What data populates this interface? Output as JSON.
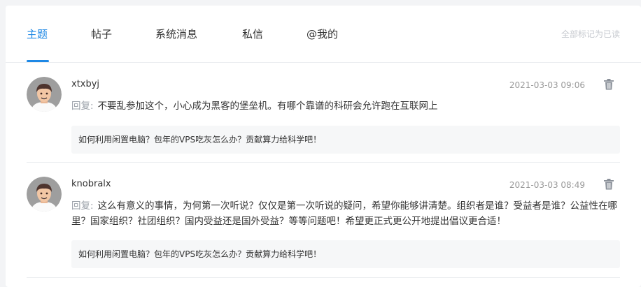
{
  "tabs": [
    {
      "label": "主题",
      "active": true
    },
    {
      "label": "帖子",
      "active": false
    },
    {
      "label": "系统消息",
      "active": false
    },
    {
      "label": "私信",
      "active": false
    },
    {
      "label": "@我的",
      "active": false
    }
  ],
  "mark_all_read": "全部标记为已读",
  "accent_color": "#1e88e5",
  "messages": [
    {
      "username": "xtxbyj",
      "time": "2021-03-03 09:06",
      "reply_label": "回复:",
      "reply_text": "不要乱参加这个，小心成为黑客的堡垒机。有哪个靠谱的科研会允许跑在互联网上",
      "quote": "如何利用闲置电脑？包年的VPS吃灰怎么办？贡献算力给科学吧！",
      "avatar_icon": "user-avatar-icon",
      "delete_icon": "trash-icon"
    },
    {
      "username": "knobralx",
      "time": "2021-03-03 08:49",
      "reply_label": "回复:",
      "reply_text": "这么有意义的事情，为何第一次听说？仅仅是第一次听说的疑问，希望你能够讲清楚。组织者是谁？受益者是谁？公益性在哪里？国家组织？社团组织？国内受益还是国外受益？等等问题吧！希望更正式更公开地提出倡议更合适！",
      "quote": "如何利用闲置电脑？包年的VPS吃灰怎么办？贡献算力给科学吧！",
      "avatar_icon": "user-avatar-icon",
      "delete_icon": "trash-icon"
    }
  ]
}
